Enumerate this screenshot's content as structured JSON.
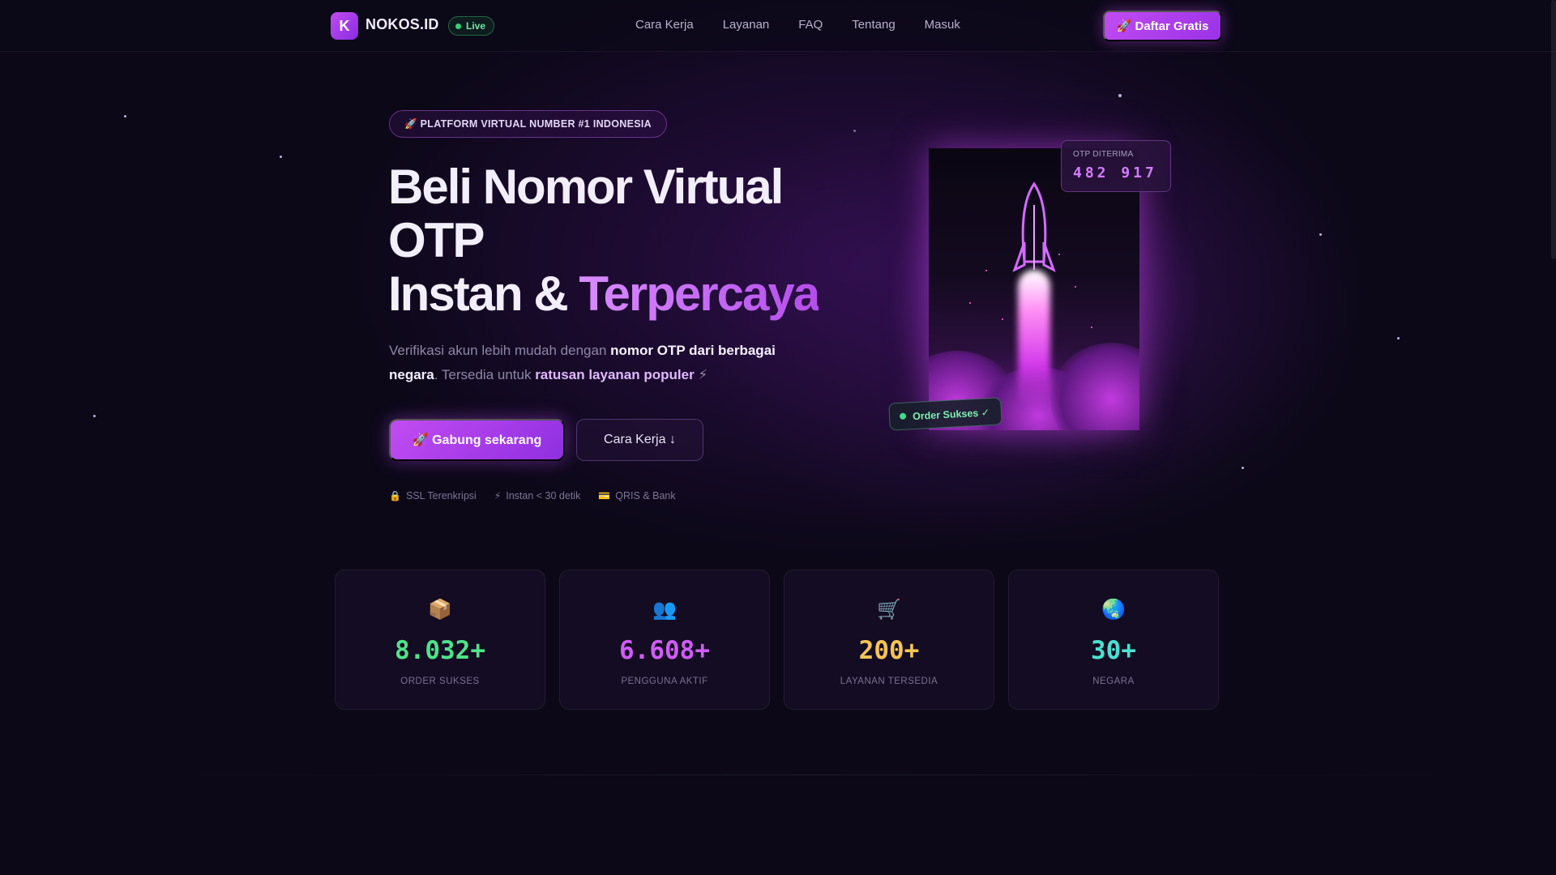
{
  "nav": {
    "logo_letter": "K",
    "brand": "NOKOS.ID",
    "live_badge": "Live",
    "links": [
      "Cara Kerja",
      "Layanan",
      "FAQ",
      "Tentang",
      "Masuk"
    ],
    "cta": "🚀 Daftar Gratis"
  },
  "hero": {
    "pill": "🚀 PLATFORM VIRTUAL NUMBER #1 INDONESIA",
    "headline_line1": "Beli Nomor Virtual",
    "headline_line2": "OTP",
    "headline_line3a": "Instan & ",
    "headline_line3b": "Terpercaya",
    "sub_part1": "Verifikasi akun lebih mudah dengan ",
    "sub_highlight1": "nomor OTP dari berbagai negara",
    "sub_part2": ". Tersedia untuk ",
    "sub_highlight2": "ratusan layanan populer",
    "sub_emoji": " ⚡",
    "primary_button": "🚀 Gabung sekarang",
    "secondary_button": "Cara Kerja ↓",
    "features": [
      {
        "icon": "🔒",
        "label": "SSL Terenkripsi"
      },
      {
        "icon": "⚡",
        "label": "Instan < 30 detik"
      },
      {
        "icon": "💳",
        "label": "QRIS & Bank"
      }
    ]
  },
  "visual": {
    "otp_label": "OTP DITERIMA",
    "otp_code": "482 917",
    "order_badge": "Order Sukses ✓"
  },
  "stats": [
    {
      "icon": "📦",
      "value": "8.032+",
      "label": "ORDER SUKSES",
      "color": "#4ee38a"
    },
    {
      "icon": "👥",
      "value": "6.608+",
      "label": "PENGGUNA AKTIF",
      "color": "#d05cf5"
    },
    {
      "icon": "🛒",
      "value": "200+",
      "label": "LAYANAN TERSEDIA",
      "color": "#f6c453"
    },
    {
      "icon": "🌏",
      "value": "30+",
      "label": "NEGARA",
      "color": "#49e0cf"
    }
  ],
  "colors": {
    "background": "#0c0818",
    "accent": "#c24cf2",
    "live": "#34d17a"
  }
}
